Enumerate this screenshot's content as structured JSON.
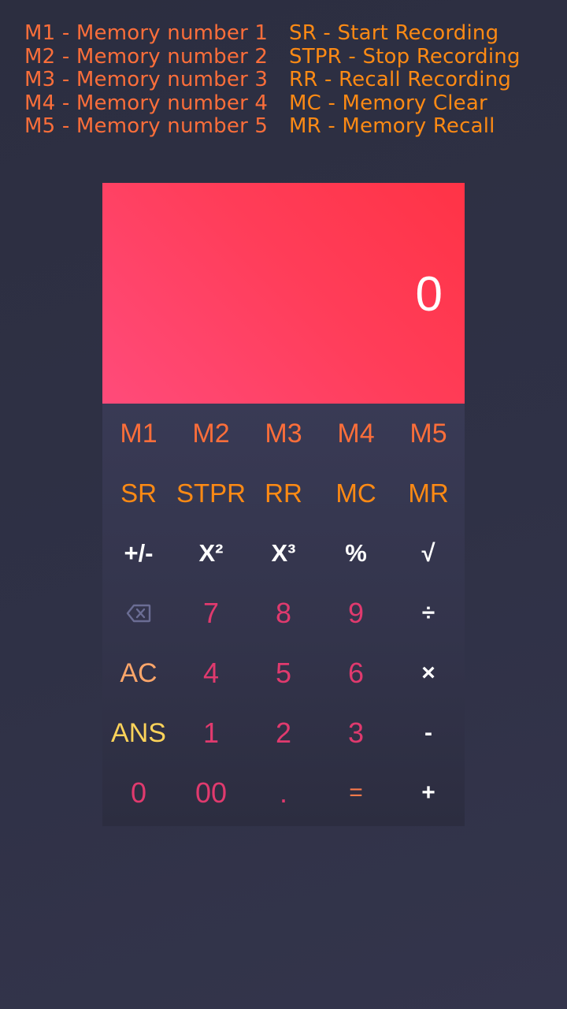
{
  "legend": {
    "left": [
      "M1 - Memory number 1",
      "M2 - Memory number 2",
      "M3 - Memory number 3",
      "M4 - Memory number 4",
      "M5 - Memory number 5"
    ],
    "right": [
      "SR - Start Recording",
      "STPR - Stop Recording",
      "RR - Recall Recording",
      "MC - Memory Clear",
      "MR - Memory Recall"
    ]
  },
  "display": {
    "value": "0"
  },
  "keypad": {
    "rows": [
      [
        "M1",
        "M2",
        "M3",
        "M4",
        "M5"
      ],
      [
        "SR",
        "STPR",
        "RR",
        "MC",
        "MR"
      ],
      [
        "+/-",
        "X²",
        "X³",
        "%",
        "√"
      ],
      [
        "",
        "7",
        "8",
        "9",
        "÷"
      ],
      [
        "AC",
        "4",
        "5",
        "6",
        "×"
      ],
      [
        "ANS",
        "1",
        "2",
        "3",
        "-"
      ],
      [
        "0",
        "00",
        ".",
        "=",
        "+"
      ]
    ],
    "backspace_icon": "backspace-icon"
  },
  "colors": {
    "background": "#2f3146",
    "display_gradient_start": "#ff4b7a",
    "display_gradient_end": "#ff3346",
    "memory_text": "#fb6e3a",
    "recording_text": "#fd8a14",
    "digit_text": "#e03a6e",
    "ans_text": "#fdd35a",
    "ac_text": "#fda66a"
  }
}
